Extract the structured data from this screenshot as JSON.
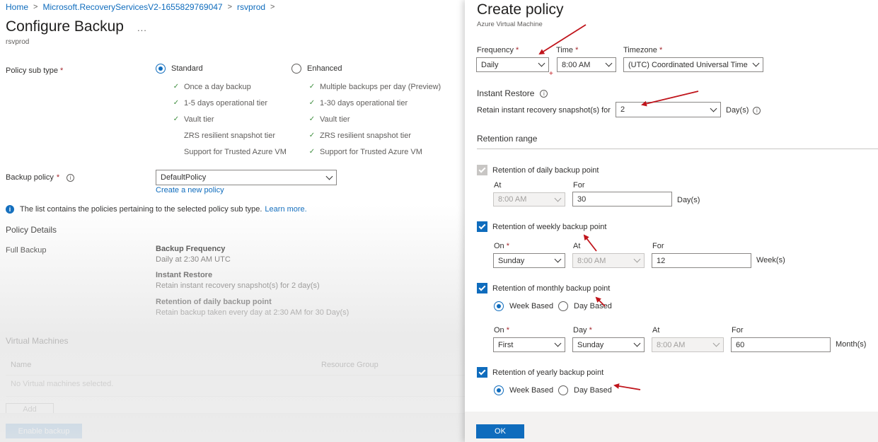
{
  "breadcrumb": [
    "Home",
    "Microsoft.RecoveryServicesV2-1655829769047",
    "rsvprod"
  ],
  "configure": {
    "title": "Configure Backup",
    "more": "...",
    "subtitle": "rsvprod",
    "policy_sub_type_label": "Policy sub type",
    "required_mark": "*",
    "standard": {
      "label": "Standard",
      "selected": true,
      "features": [
        "Once a day backup",
        "1-5 days operational tier",
        "Vault tier",
        "ZRS resilient snapshot tier",
        "Support for Trusted Azure VM"
      ],
      "checked": [
        true,
        true,
        true,
        false,
        false
      ]
    },
    "enhanced": {
      "label": "Enhanced",
      "selected": false,
      "features": [
        "Multiple backups per day (Preview)",
        "1-30 days operational tier",
        "Vault tier",
        "ZRS resilient snapshot tier",
        "Support for Trusted Azure VM"
      ],
      "checked": [
        true,
        true,
        true,
        true,
        true
      ]
    },
    "backup_policy_label": "Backup policy",
    "backup_policy_value": "DefaultPolicy",
    "create_new_policy": "Create a new policy",
    "info_text": "The list contains the policies pertaining to the selected policy sub type.",
    "learn_more": "Learn more.",
    "policy_details_heading": "Policy Details",
    "full_backup_label": "Full Backup",
    "details": [
      {
        "title": "Backup Frequency",
        "text": "Daily at 2:30 AM UTC"
      },
      {
        "title": "Instant Restore",
        "text": "Retain instant recovery snapshot(s) for 2 day(s)"
      },
      {
        "title": "Retention of daily backup point",
        "text": "Retain backup taken every day at 2:30 AM for 30 Day(s)"
      }
    ],
    "vm_heading": "Virtual Machines",
    "vm_columns": [
      "Name",
      "Resource Group"
    ],
    "vm_empty": "No Virtual machines selected.",
    "add_button": "Add",
    "enable_button": "Enable backup"
  },
  "policy": {
    "title": "Create policy",
    "subtitle": "Azure Virtual Machine",
    "frequency_label": "Frequency",
    "frequency_value": "Daily",
    "time_label": "Time",
    "time_value": "8:00 AM",
    "timezone_label": "Timezone",
    "timezone_value": "(UTC) Coordinated Universal Time",
    "instant_restore_heading": "Instant Restore",
    "retain_label": "Retain instant recovery snapshot(s) for",
    "retain_value": "2",
    "retain_unit": "Day(s)",
    "retention_range_heading": "Retention range",
    "daily": {
      "label": "Retention of daily backup point",
      "checked": true,
      "disabled": true,
      "at_label": "At",
      "at_value": "8:00 AM",
      "for_label": "For",
      "for_value": "30",
      "unit": "Day(s)"
    },
    "weekly": {
      "label": "Retention of weekly backup point",
      "checked": true,
      "on_label": "On",
      "on_value": "Sunday",
      "at_label": "At",
      "at_value": "8:00 AM",
      "for_label": "For",
      "for_value": "12",
      "unit": "Week(s)"
    },
    "monthly": {
      "label": "Retention of monthly backup point",
      "checked": true,
      "week_based": "Week Based",
      "day_based": "Day Based",
      "selected": "Week Based",
      "on_label": "On",
      "on_value": "First",
      "day_label": "Day",
      "day_value": "Sunday",
      "at_label": "At",
      "at_value": "8:00 AM",
      "for_label": "For",
      "for_value": "60",
      "unit": "Month(s)"
    },
    "yearly": {
      "label": "Retention of yearly backup point",
      "checked": true,
      "week_based": "Week Based",
      "day_based": "Day Based",
      "selected": "Week Based"
    },
    "ok_button": "OK"
  },
  "annotation_color": "#c0141b"
}
